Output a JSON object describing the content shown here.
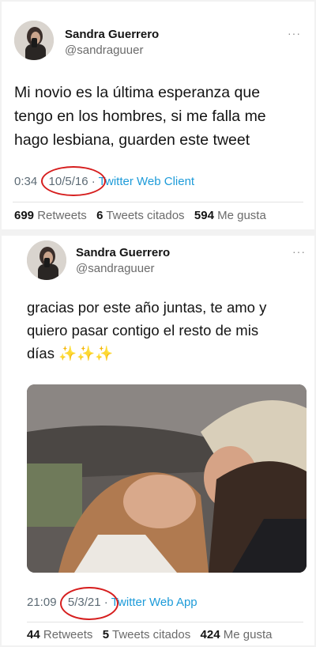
{
  "tweet1": {
    "name": "Sandra Guerrero",
    "handle": "@sandraguuer",
    "more": "···",
    "text_lines": [
      "Mi novio es la última esperanza que",
      "tengo en los hombres, si me falla me",
      "hago lesbiana, guarden este tweet"
    ],
    "time": "0:34",
    "date": "10/5/16",
    "separator": "·",
    "source": "Twitter Web Client",
    "retweets_count": "699",
    "retweets_label": "Retweets",
    "quotes_count": "6",
    "quotes_label": "Tweets citados",
    "likes_count": "594",
    "likes_label": "Me gusta"
  },
  "tweet2": {
    "name": "Sandra Guerrero",
    "handle": "@sandraguuer",
    "more": "···",
    "text_lines": [
      "gracias por este año juntas, te amo y",
      "quiero pasar contigo el resto de mis",
      "días ✨✨✨"
    ],
    "time": "21:09",
    "date": "5/3/21",
    "separator": "·",
    "source": "Twitter Web App",
    "retweets_count": "44",
    "retweets_label": "Retweets",
    "quotes_count": "5",
    "quotes_label": "Tweets citados",
    "likes_count": "424",
    "likes_label": "Me gusta"
  },
  "colors": {
    "link": "#1d9bd9",
    "annotation_circle": "#d61e1e",
    "meta": "#5d6b75"
  }
}
